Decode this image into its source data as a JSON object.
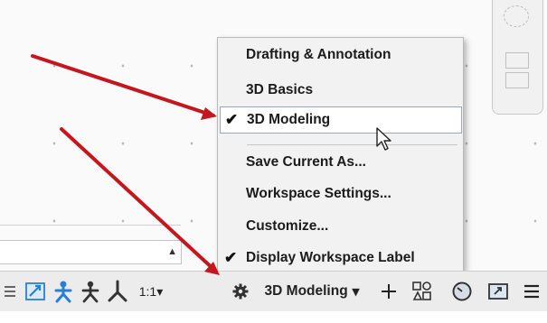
{
  "workspace_menu": {
    "items": [
      {
        "label": "Drafting & Annotation",
        "checked": false
      },
      {
        "label": "3D Basics",
        "checked": false
      },
      {
        "label": "3D Modeling",
        "checked": true,
        "highlighted": true
      },
      {
        "label": "Save Current As...",
        "checked": false
      },
      {
        "label": "Workspace Settings...",
        "checked": false
      },
      {
        "label": "Customize...",
        "checked": false
      },
      {
        "label": "Display Workspace Label",
        "checked": true
      }
    ],
    "check_glyph": "✔"
  },
  "status_bar": {
    "annotation_scale": "1:1",
    "annotation_scale_caret": "▾",
    "workspace_label": "3D Modeling",
    "workspace_caret": "▾",
    "icons": [
      "menu-lines-icon",
      "annotation-monitor-icon",
      "annotation-visibility-icon",
      "auto-scale-icon",
      "ucs-icon",
      "workspace-gear-icon",
      "plus-icon",
      "isolate-objects-icon",
      "hardware-accel-icon",
      "clean-screen-icon",
      "customization-icon"
    ]
  },
  "command_line": {
    "scroll_glyph": "▲"
  },
  "colors": {
    "arrow": "#c4161c",
    "accent_blue": "#2a7fd4",
    "menu_bg": "#f2f2f2",
    "status_bg": "#ececec"
  }
}
